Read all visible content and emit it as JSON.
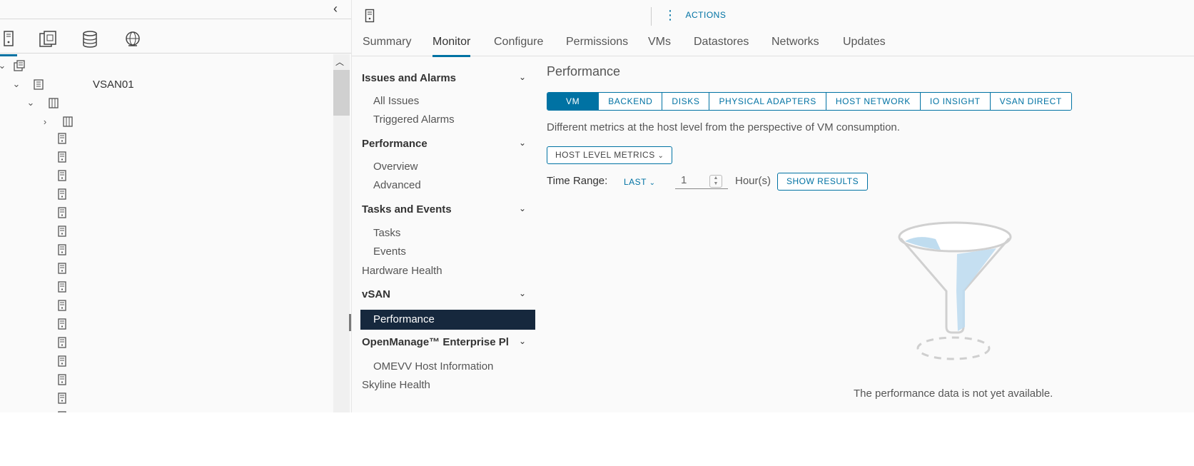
{
  "left_panel": {
    "tabs": [
      "hosts-and-clusters-icon",
      "vms-and-templates-icon",
      "storage-icon",
      "networking-icon"
    ],
    "tree": {
      "root_icon": "datacenter-icon",
      "cluster_label": "VSAN01",
      "hosts": [
        "host-icon",
        "host-icon",
        "host-icon",
        "host-icon",
        "host-icon",
        "host-icon",
        "host-icon",
        "host-icon",
        "host-icon",
        "host-icon",
        "host-icon",
        "host-icon",
        "host-icon",
        "host-icon",
        "host-icon",
        "host-icon"
      ]
    }
  },
  "header": {
    "object_icon": "host-icon",
    "actions_label": "ACTIONS",
    "tabs": [
      {
        "label": "Summary"
      },
      {
        "label": "Monitor"
      },
      {
        "label": "Configure"
      },
      {
        "label": "Permissions"
      },
      {
        "label": "VMs"
      },
      {
        "label": "Datastores"
      },
      {
        "label": "Networks"
      },
      {
        "label": "Updates"
      }
    ],
    "active_tab": "Monitor"
  },
  "monitor_nav": {
    "issues": {
      "title": "Issues and Alarms",
      "items": [
        "All Issues",
        "Triggered Alarms"
      ]
    },
    "performance": {
      "title": "Performance",
      "items": [
        "Overview",
        "Advanced"
      ]
    },
    "tasks": {
      "title": "Tasks and Events",
      "items": [
        "Tasks",
        "Events"
      ]
    },
    "hardware_health": "Hardware Health",
    "vsan": {
      "title": "vSAN",
      "items": [
        "Performance"
      ]
    },
    "openmanage": {
      "title": "OpenManage™ Enterprise Pl",
      "items": [
        "OMEVV Host Information"
      ]
    },
    "skyline_health": "Skyline Health"
  },
  "content": {
    "title": "Performance",
    "segments": [
      "VM",
      "BACKEND",
      "DISKS",
      "PHYSICAL ADAPTERS",
      "HOST NETWORK",
      "IO INSIGHT",
      "VSAN DIRECT"
    ],
    "active_segment": "VM",
    "description": "Different metrics at the host level from the perspective of VM consumption.",
    "metrics_dropdown": "HOST LEVEL METRICS",
    "time_range_label": "Time Range:",
    "time_range_mode": "LAST",
    "time_range_value": "1",
    "time_range_unit": "Hour(s)",
    "show_results_label": "SHOW RESULTS",
    "empty_icon": "funnel-icon",
    "empty_message": "The performance data is not yet available."
  }
}
